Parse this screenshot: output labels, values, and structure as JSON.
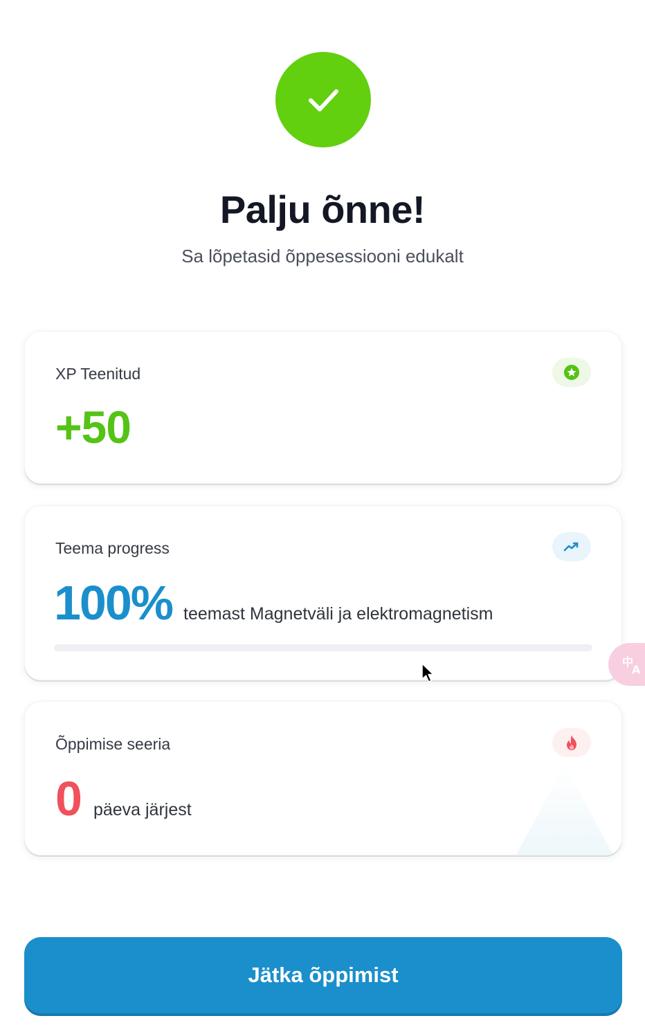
{
  "header": {
    "icon": "checkmark-icon",
    "title": "Palju õnne!",
    "subtitle": "Sa lõpetasid õppesessiooni edukalt"
  },
  "xp_card": {
    "label": "XP Teenitud",
    "value": "+50",
    "icon": "star-badge-icon"
  },
  "progress_card": {
    "label": "Teema progress",
    "value": "100%",
    "topic_text": "teemast Magnetväli ja elektromagnetism",
    "icon": "trending-up-icon",
    "progress_fraction": 1.0
  },
  "streak_card": {
    "label": "Õppimise seeria",
    "value": "0",
    "unit": "päeva järjest",
    "icon": "flame-icon"
  },
  "continue_button": {
    "label": "Jätka õppimist"
  },
  "overlay": {
    "translate_icon": "translate-icon",
    "cursor_icon": "mouse-cursor-icon"
  },
  "colors": {
    "success_green": "#62cf0f",
    "xp_green": "#54c315",
    "primary_blue": "#1b8fcb",
    "streak_red": "#f0515c",
    "title_dark": "#141824"
  }
}
